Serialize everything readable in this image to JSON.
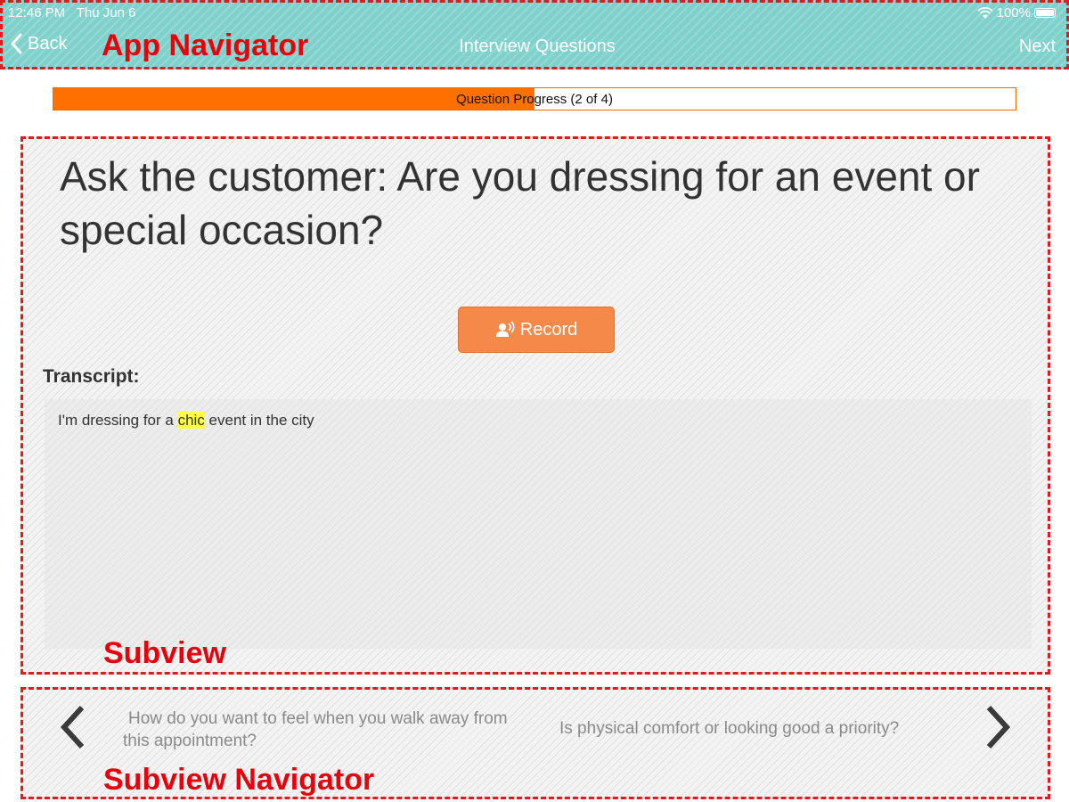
{
  "status_bar": {
    "time": "12:46 PM",
    "date": "Thu Jun 6",
    "battery": "100%"
  },
  "app_nav": {
    "back_label": "Back",
    "title": "Interview Questions",
    "next_label": "Next",
    "annotation": "App Navigator",
    "color": "#7fd1cc"
  },
  "progress": {
    "label": "Question Progress (2 of 4)",
    "current": 2,
    "total": 4,
    "fraction": 0.5,
    "color": "#ff7000"
  },
  "subview": {
    "question": "Ask the customer: Are you dressing for an event or special occasion?",
    "record_label": "Record",
    "record_color": "#f5894a",
    "transcript_label": "Transcript:",
    "transcript": {
      "before": "I'm dressing for a ",
      "highlight": "chic",
      "after": " event in the city",
      "highlight_color": "#ffff44"
    },
    "annotation": "Subview"
  },
  "subview_nav": {
    "prev_question": "How do you want to feel when you walk away from this appointment?",
    "next_question": "Is physical comfort or looking good a priority?",
    "annotation": "Subview Navigator"
  },
  "annotation_color": "#e8000b"
}
